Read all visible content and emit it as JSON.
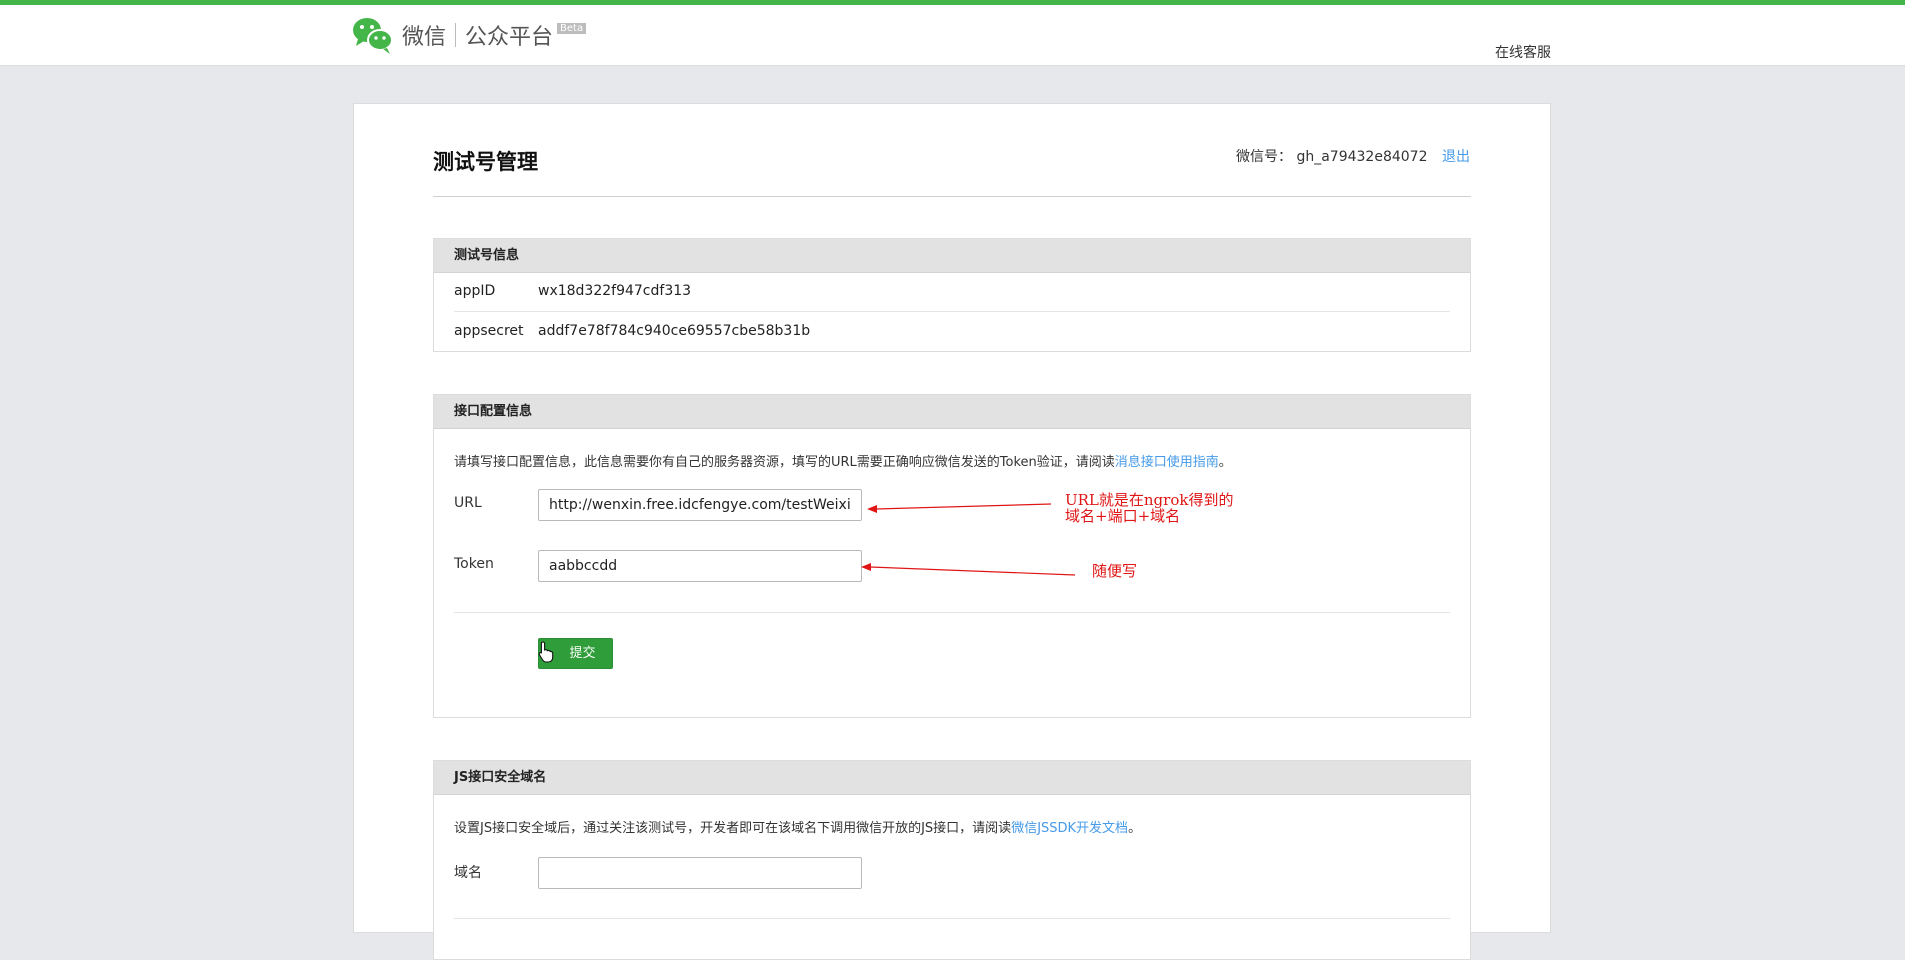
{
  "header": {
    "brand": "微信",
    "product": "公众平台",
    "beta": "Beta",
    "support_link": "在线客服"
  },
  "page": {
    "title": "测试号管理",
    "account_label": "微信号：",
    "account_id": "gh_a79432e84072",
    "logout": "退出"
  },
  "test_account": {
    "heading": "测试号信息",
    "rows": [
      {
        "key": "appID",
        "value": "wx18d322f947cdf313"
      },
      {
        "key": "appsecret",
        "value": "addf7e78f784c940ce69557cbe58b31b"
      }
    ]
  },
  "interface_config": {
    "heading": "接口配置信息",
    "description": "请填写接口配置信息，此信息需要你有自己的服务器资源，填写的URL需要正确响应微信发送的Token验证，请阅读",
    "guide_link": "消息接口使用指南",
    "description_end": "。",
    "url_label": "URL",
    "url_value": "http://wenxin.free.idcfengye.com/testWeixin",
    "token_label": "Token",
    "token_value": "aabbccdd",
    "submit": "提交"
  },
  "js_domain": {
    "heading": "JS接口安全域名",
    "description": "设置JS接口安全域后，通过关注该测试号，开发者即可在该域名下调用微信开放的JS接口，请阅读",
    "doc_link": "微信JSSDK开发文档",
    "description_end": "。",
    "domain_label": "域名",
    "domain_value": ""
  },
  "annotations": {
    "url_note_line1": "URL就是在ngrok得到的",
    "url_note_line2": "域名+端口+域名",
    "token_note": "随便写",
    "color": "#e01616"
  },
  "colors": {
    "brand_green": "#44b549",
    "button_green": "#2f9e3a",
    "link_blue": "#459ae9",
    "page_bg": "#e7e8eb"
  },
  "icons": [
    "wechat-logo-icon",
    "hand-cursor-icon"
  ]
}
